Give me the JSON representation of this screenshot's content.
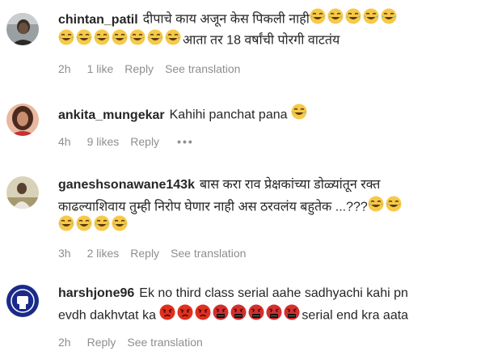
{
  "comments": [
    {
      "username": "chintan_patil",
      "line1_text": "दीपाचे काय अजून केस पिकली नाही",
      "line1_emojis": [
        "laugh",
        "laugh",
        "laugh",
        "laugh",
        "laugh"
      ],
      "line2_emojis": [
        "laugh",
        "laugh",
        "laugh",
        "laugh",
        "laugh",
        "laugh",
        "laugh"
      ],
      "line2_text": "आता तर 18 वर्षांची पोरगी वाटतंय",
      "time": "2h",
      "likes": "1 like",
      "reply": "Reply",
      "translation": "See translation"
    },
    {
      "username": "ankita_mungekar",
      "line1_text": "Kahihi panchat pana",
      "line1_emojis": [
        "laugh"
      ],
      "time": "4h",
      "likes": "9 likes",
      "reply": "Reply",
      "more": "•••"
    },
    {
      "username": "ganeshsonawane143k",
      "line1_text": "बास करा राव प्रेक्षकांच्या डोळ्यांतून रक्त",
      "line2_text": "काढल्याशिवाय तुम्ही निरोप घेणार नाही अस ठरवलंय बहुतेक ...???",
      "line2_emojis": [
        "laugh",
        "laugh"
      ],
      "line3_emojis": [
        "laugh",
        "laugh",
        "laugh",
        "laugh"
      ],
      "time": "3h",
      "likes": "2 likes",
      "reply": "Reply",
      "translation": "See translation"
    },
    {
      "username": "harshjone96",
      "line1_text": "Ek no third class serial aahe sadhyachi kahi pn",
      "line2_text_a": "evdh dakhvtat ka",
      "line2_emojis": [
        "angry",
        "angry",
        "angry",
        "cursing",
        "cursing",
        "cursing",
        "cursing",
        "cursing"
      ],
      "line2_text_b": "serial end kra aata",
      "time": "2h",
      "reply": "Reply",
      "translation": "See translation"
    }
  ],
  "colors": {
    "meta": "#8e8e8e",
    "laugh_face": "#f7c948",
    "angry_face": "#e0301e",
    "cursing_face": "#d32f2f"
  }
}
